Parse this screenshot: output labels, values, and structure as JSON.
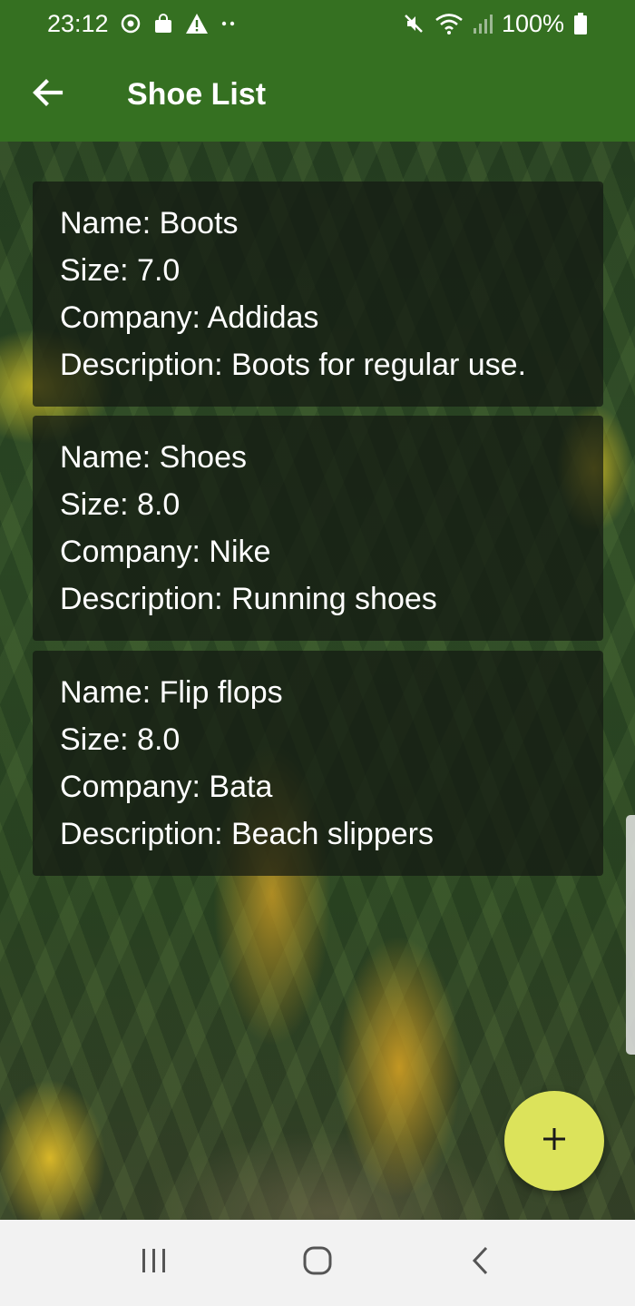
{
  "colors": {
    "primary": "#357021",
    "accent": "#dce35b",
    "card_background": "rgba(20,25,18,0.72)",
    "text_on_dark": "#ffffff"
  },
  "status_bar": {
    "time": "23:12",
    "battery": "100%",
    "icons": [
      "camera-sync-icon",
      "shopping-bag-icon",
      "warning-icon",
      "more-dots-icon",
      "mute-icon",
      "wifi-icon",
      "signal-icon",
      "battery-icon"
    ]
  },
  "toolbar": {
    "back_icon": "arrow-back-icon",
    "title": "Shoe List"
  },
  "shoes": [
    {
      "name": "Name: Boots",
      "size": "Size: 7.0",
      "company": "Company: Addidas",
      "description": "Description: Boots for regular use."
    },
    {
      "name": "Name: Shoes",
      "size": "Size: 8.0",
      "company": "Company: Nike",
      "description": "Description: Running shoes"
    },
    {
      "name": "Name: Flip flops",
      "size": "Size: 8.0",
      "company": "Company: Bata",
      "description": "Description: Beach slippers"
    }
  ],
  "fab": {
    "icon": "plus-icon"
  },
  "nav_bar": {
    "icons": [
      "recent-apps-icon",
      "home-icon",
      "back-chevron-icon"
    ]
  }
}
